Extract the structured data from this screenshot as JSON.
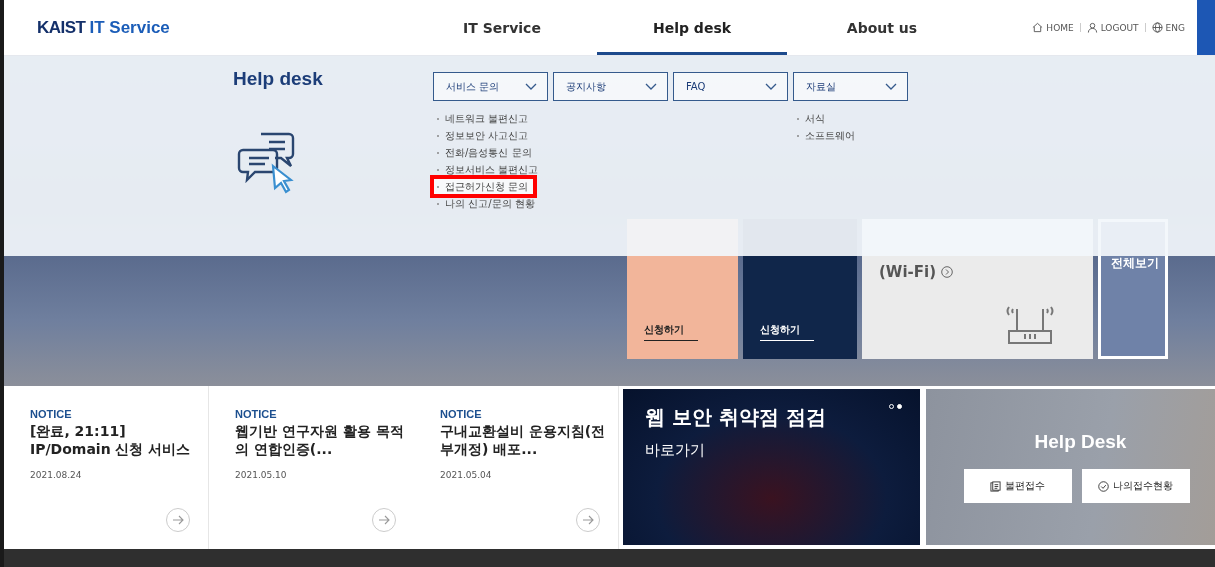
{
  "header": {
    "logo": {
      "brand": "KAIST",
      "suffix": "IT Service"
    },
    "nav": [
      {
        "label": "IT Service",
        "selected": false
      },
      {
        "label": "Help desk",
        "selected": true
      },
      {
        "label": "About us",
        "selected": false
      }
    ],
    "utility": [
      {
        "kind": "home",
        "label": "HOME"
      },
      {
        "kind": "user",
        "label": "LOGOUT"
      },
      {
        "kind": "globe",
        "label": "ENG"
      }
    ]
  },
  "menu": {
    "title": "Help desk",
    "columns": [
      {
        "label": "서비스 문의",
        "items": [
          {
            "label": "네트워크 불편신고",
            "highlighted": false
          },
          {
            "label": "정보보안 사고신고",
            "highlighted": false
          },
          {
            "label": "전화/음성통신 문의",
            "highlighted": false
          },
          {
            "label": "정보서비스 불편신고",
            "highlighted": false
          },
          {
            "label": "접근허가신청 문의",
            "highlighted": true
          },
          {
            "label": "나의 신고/문의 현황",
            "highlighted": false
          }
        ]
      },
      {
        "label": "공지사항"
      },
      {
        "label": "FAQ"
      },
      {
        "label": "자료실",
        "items": [
          {
            "label": "서식",
            "highlighted": false
          },
          {
            "label": "소프트웨어",
            "highlighted": false
          }
        ]
      }
    ]
  },
  "tiles": [
    {
      "kind": "accent",
      "text": "신청하기"
    },
    {
      "kind": "dark",
      "text": "신청하기"
    },
    {
      "kind": "wifi",
      "text": "(Wi-Fi)"
    },
    {
      "kind": "all",
      "text": "전체보기"
    }
  ],
  "notices": [
    {
      "tag": "NOTICE",
      "title": "[완료, 21:11] IP/Domain 신청 서비스",
      "date": "2021.08.24"
    },
    {
      "tag": "NOTICE",
      "title": "웹기반 연구자원 활용 목적의 연합인증(...",
      "date": "2021.05.10"
    },
    {
      "tag": "NOTICE",
      "title": "구내교환설비 운용지침(전부개정) 배포...",
      "date": "2021.05.04"
    }
  ],
  "promo": {
    "title": "웹 보안 취약점 점검",
    "link": "바로가기",
    "dots": [
      {
        "selected": false
      },
      {
        "selected": true
      }
    ]
  },
  "helpdesk": {
    "title": "Help Desk",
    "buttons": [
      {
        "kind": "report",
        "label": "불편접수"
      },
      {
        "kind": "status",
        "label": "나의접수현황"
      }
    ]
  }
}
